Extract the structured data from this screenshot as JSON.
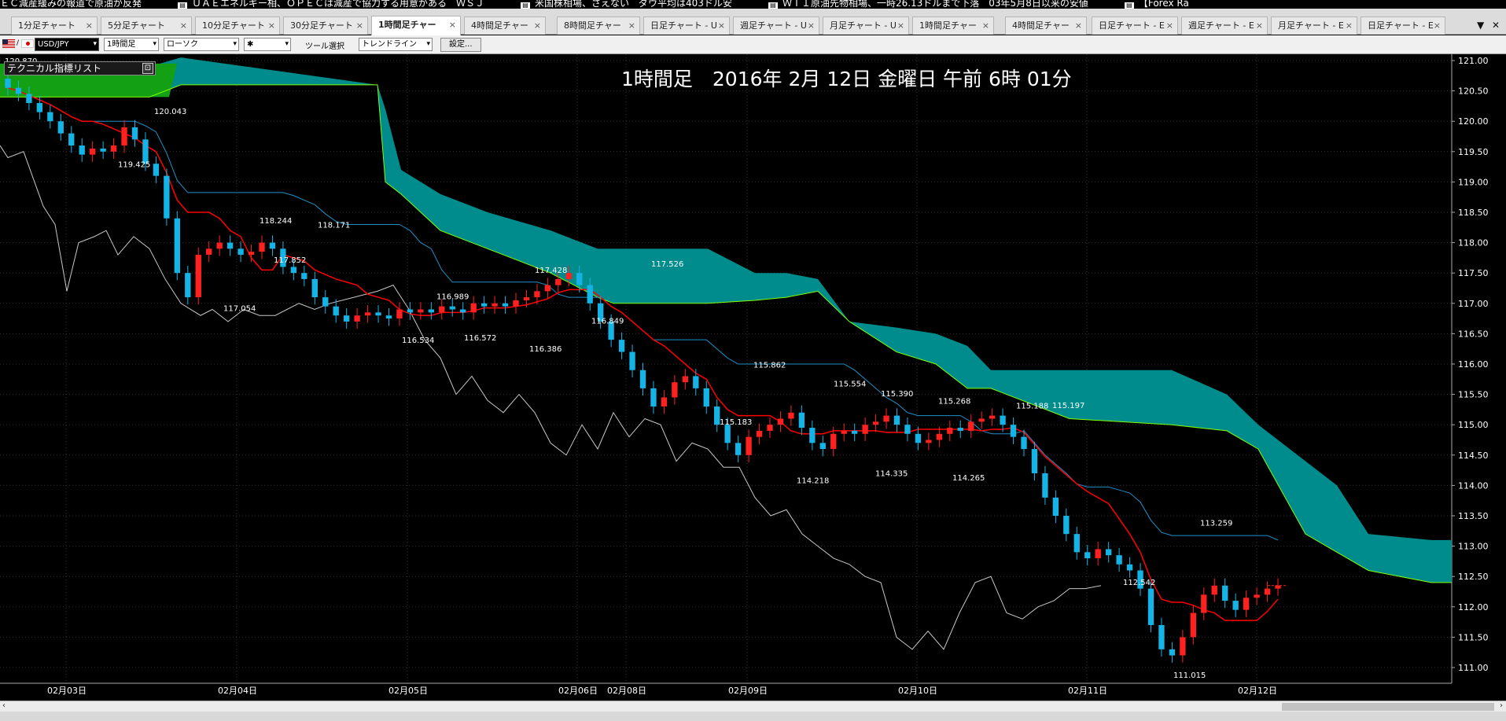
{
  "ticker": [
    "ＥＣ減産緩みの報道で原油が反発",
    "ＵＡＥエネルギー相、ＯＰＥＣは減産で協力する用意がある　ＷＳＪ",
    "米国株相場、さえない　ダウ平均は403ドル安",
    "ＷＴＩ原油先物相場、一時26.13ドルまで下落　03年5月8日以来の安値",
    "【Forex Ra"
  ],
  "tabs": [
    "1分足チャート",
    "5分足チャート",
    "10分足チャート",
    "30分足チャート",
    "1時間足チャー",
    "4時間足チャー",
    "8時間足チャー",
    "日足チャート - U",
    "週足チャート - U",
    "月足チャート - U",
    "1時間足チャー",
    "4時間足チャー",
    "日足チャート - E",
    "週足チャート - E",
    "月足チャート - E",
    "日足チャート - E"
  ],
  "active_tab": 4,
  "tab_controls": {
    "dropdown": "▼",
    "close": "✕"
  },
  "toolbar": {
    "symbol": "USD/JPY",
    "timeframe": "1時間足",
    "chart_type": "ローソク",
    "style": "✱",
    "tool_label": "ツール選択",
    "tool_value": "トレンドライン",
    "settings_label": "設定..."
  },
  "indicator_panel": {
    "title": "テクニカル指標リスト",
    "close": "⊡"
  },
  "chart_title": "1時間足　2016年 2月 12日 金曜日 午前 6時 01分",
  "colors": {
    "bull": "#ff2020",
    "bear": "#14b4e6",
    "base_line": "#ff0000",
    "conv_line": "#1e90c8",
    "lag_line": "#c8c8c8",
    "kumo_bear": "#008c8c",
    "kumo_bull": "#14a014",
    "span_b": "#7fff00"
  },
  "chart_data": {
    "type": "candlestick",
    "symbol": "USD/JPY",
    "ylim": [
      110.8,
      121.1
    ],
    "y_ticks": [
      "121.00",
      "120.50",
      "120.00",
      "119.50",
      "119.00",
      "118.50",
      "118.00",
      "117.50",
      "117.00",
      "116.50",
      "116.00",
      "115.50",
      "115.00",
      "114.50",
      "114.00",
      "113.50",
      "113.00",
      "112.50",
      "112.00",
      "111.50",
      "111.00"
    ],
    "x_ticks": [
      "02月03日",
      "02月04日",
      "02月05日",
      "02月06日",
      "02月08日",
      "02月09日",
      "02月10日",
      "02月11日",
      "02月12日"
    ],
    "annotations": [
      {
        "label": "120.870",
        "value": 120.87
      },
      {
        "label": "120.043",
        "value": 120.043
      },
      {
        "label": "119.425",
        "value": 119.425
      },
      {
        "label": "118.244",
        "value": 118.244
      },
      {
        "label": "118.171",
        "value": 118.171
      },
      {
        "label": "117.852",
        "value": 117.852
      },
      {
        "label": "117.054",
        "value": 117.054
      },
      {
        "label": "116.989",
        "value": 116.989
      },
      {
        "label": "116.534",
        "value": 116.534
      },
      {
        "label": "116.572",
        "value": 116.572
      },
      {
        "label": "117.428",
        "value": 117.428
      },
      {
        "label": "116.849",
        "value": 116.849
      },
      {
        "label": "116.386",
        "value": 116.386
      },
      {
        "label": "117.526",
        "value": 117.526
      },
      {
        "label": "115.862",
        "value": 115.862
      },
      {
        "label": "115.183",
        "value": 115.183
      },
      {
        "label": "115.554",
        "value": 115.554
      },
      {
        "label": "115.390",
        "value": 115.39
      },
      {
        "label": "114.218",
        "value": 114.218
      },
      {
        "label": "114.335",
        "value": 114.335
      },
      {
        "label": "115.268",
        "value": 115.268
      },
      {
        "label": "114.265",
        "value": 114.265
      },
      {
        "label": "115.188",
        "value": 115.188
      },
      {
        "label": "115.197",
        "value": 115.197
      },
      {
        "label": "113.259",
        "value": 113.259
      },
      {
        "label": "112.542",
        "value": 112.542
      },
      {
        "label": "111.015",
        "value": 111.015
      }
    ],
    "close_series": [
      120.55,
      120.45,
      120.3,
      120.15,
      120.0,
      119.8,
      119.6,
      119.45,
      119.55,
      119.5,
      119.6,
      119.9,
      119.7,
      119.3,
      119.1,
      118.4,
      117.5,
      117.1,
      117.8,
      117.9,
      118.0,
      117.9,
      117.8,
      117.85,
      118.0,
      117.9,
      117.6,
      117.5,
      117.4,
      117.1,
      116.95,
      116.8,
      116.7,
      116.8,
      116.85,
      116.8,
      116.75,
      116.9,
      116.85,
      116.9,
      116.85,
      116.95,
      116.9,
      116.85,
      117.0,
      116.95,
      117.0,
      116.95,
      117.05,
      117.1,
      117.2,
      117.3,
      117.4,
      117.5,
      117.3,
      117.0,
      116.7,
      116.4,
      116.2,
      115.9,
      115.6,
      115.3,
      115.45,
      115.7,
      115.8,
      115.6,
      115.3,
      115.0,
      114.7,
      114.5,
      114.8,
      114.9,
      115.0,
      115.1,
      115.2,
      114.95,
      114.7,
      114.6,
      114.85,
      114.9,
      114.85,
      115.0,
      115.05,
      115.15,
      115.0,
      114.85,
      114.7,
      114.75,
      114.85,
      114.95,
      114.9,
      115.05,
      115.1,
      115.15,
      115.0,
      114.8,
      114.6,
      114.2,
      113.8,
      113.5,
      113.2,
      112.9,
      112.8,
      112.95,
      112.85,
      112.7,
      112.6,
      112.3,
      111.7,
      111.3,
      111.2,
      111.5,
      111.9,
      112.2,
      112.35,
      112.1,
      111.95,
      112.15,
      112.2,
      112.3,
      112.35
    ]
  }
}
